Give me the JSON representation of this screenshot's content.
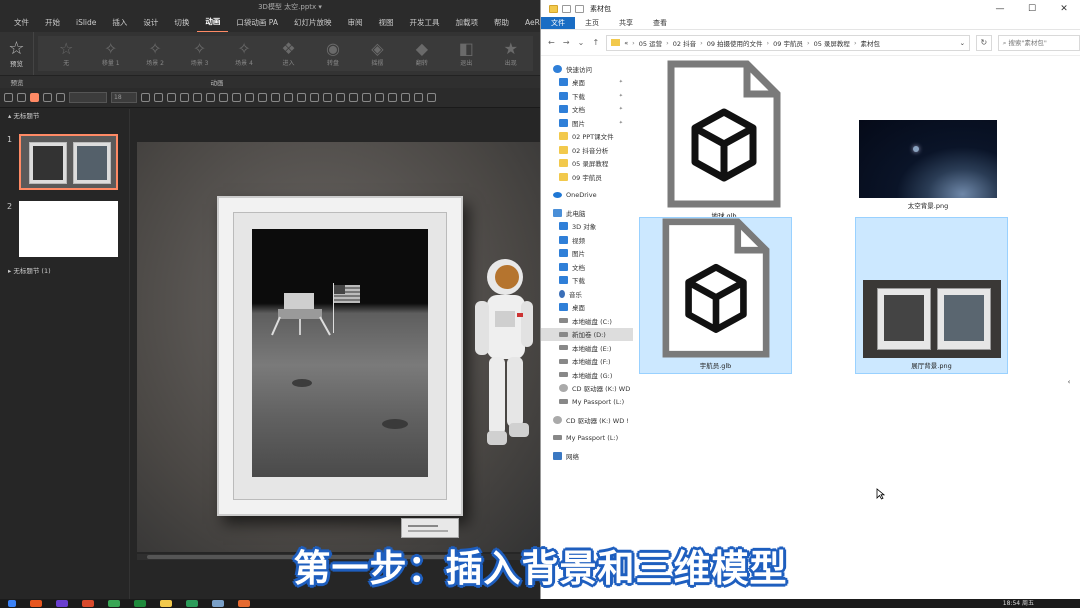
{
  "ppt": {
    "title": "3D模型  太空.pptx  ▾",
    "menu": [
      "文件",
      "开始",
      "iSlide",
      "插入",
      "设计",
      "切换",
      "动画",
      "口袋动画 PA",
      "幻灯片放映",
      "审阅",
      "视图",
      "开发工具",
      "加载项",
      "帮助",
      "AeRender"
    ],
    "active_menu_index": 6,
    "preview_label": "预览",
    "anims": [
      "无",
      "移量 1",
      "场景 2",
      "场景 3",
      "场景 4",
      "进入",
      "转盘",
      "摇摆",
      "翻转",
      "退出",
      "出现"
    ],
    "ribbon_group_left": "预览",
    "ribbon_group_center": "动画",
    "size_field": "18",
    "sections": {
      "first": "无标题节",
      "second": "无标题节 (1)"
    },
    "slides": [
      "1",
      "2"
    ]
  },
  "explorer": {
    "title": "素材包",
    "window_controls": [
      "—",
      "☐",
      "✕"
    ],
    "ribbon_tabs": [
      "文件",
      "主页",
      "共享",
      "查看"
    ],
    "address_crumbs": [
      "«",
      "05 运营",
      "02 抖音",
      "09 拍摄使用的文件",
      "09 宇航员",
      "05 录屏教程",
      "素材包"
    ],
    "search_placeholder": "搜索\"素材包\"",
    "nav_items": [
      {
        "label": "快速访问",
        "icon": "star",
        "indent": 0
      },
      {
        "label": "桌面",
        "icon": "blue",
        "indent": 1,
        "pinned": true
      },
      {
        "label": "下载",
        "icon": "blue",
        "indent": 1,
        "pinned": true
      },
      {
        "label": "文档",
        "icon": "blue",
        "indent": 1,
        "pinned": true
      },
      {
        "label": "图片",
        "icon": "blue",
        "indent": 1,
        "pinned": true
      },
      {
        "label": "02 PPT课文件",
        "icon": "folder",
        "indent": 1
      },
      {
        "label": "02 抖音分析",
        "icon": "folder",
        "indent": 1
      },
      {
        "label": "05 录屏教程",
        "icon": "folder",
        "indent": 1
      },
      {
        "label": "09 宇航员",
        "icon": "folder",
        "indent": 1
      },
      {
        "label": "",
        "icon": "",
        "indent": 0
      },
      {
        "label": "OneDrive",
        "icon": "cloud",
        "indent": 0
      },
      {
        "label": "",
        "icon": "",
        "indent": 0
      },
      {
        "label": "此电脑",
        "icon": "pc",
        "indent": 0
      },
      {
        "label": "3D 对象",
        "icon": "blue",
        "indent": 1
      },
      {
        "label": "视频",
        "icon": "blue",
        "indent": 1
      },
      {
        "label": "图片",
        "icon": "blue",
        "indent": 1
      },
      {
        "label": "文档",
        "icon": "blue",
        "indent": 1
      },
      {
        "label": "下载",
        "icon": "blue",
        "indent": 1
      },
      {
        "label": "音乐",
        "icon": "music",
        "indent": 1
      },
      {
        "label": "桌面",
        "icon": "blue",
        "indent": 1
      },
      {
        "label": "本地磁盘 (C:)",
        "icon": "drive",
        "indent": 1
      },
      {
        "label": "新加卷 (D:)",
        "icon": "drive",
        "indent": 1,
        "selected": true
      },
      {
        "label": "本地磁盘 (E:)",
        "icon": "drive",
        "indent": 1
      },
      {
        "label": "本地磁盘 (F:)",
        "icon": "drive",
        "indent": 1
      },
      {
        "label": "本地磁盘 (G:)",
        "icon": "drive",
        "indent": 1
      },
      {
        "label": "CD 驱动器 (K:) WD",
        "icon": "cd",
        "indent": 1
      },
      {
        "label": "My Passport (L:)",
        "icon": "drive",
        "indent": 1
      },
      {
        "label": "",
        "icon": "",
        "indent": 0
      },
      {
        "label": "CD 驱动器 (K:) WD !",
        "icon": "cd",
        "indent": 0
      },
      {
        "label": "",
        "icon": "",
        "indent": 0
      },
      {
        "label": "My Passport (L:)",
        "icon": "drive",
        "indent": 0
      },
      {
        "label": "",
        "icon": "",
        "indent": 0
      },
      {
        "label": "网络",
        "icon": "net",
        "indent": 0
      }
    ],
    "files": [
      {
        "name": "地球.glb",
        "kind": "glb",
        "selected": false
      },
      {
        "name": "太空背景.png",
        "kind": "space",
        "selected": false
      },
      {
        "name": "宇航员.glb",
        "kind": "glb",
        "selected": true
      },
      {
        "name": "展厅背景.png",
        "kind": "hall",
        "selected": true
      }
    ]
  },
  "caption": "第一步：插入背景和三维模型",
  "taskbar": {
    "clock": "18:54 周五"
  },
  "colors": {
    "accent": "#ff8a65",
    "explorer_blue": "#1a6dc4",
    "selection": "#cce8ff",
    "caption_outline": "#1f5fbf"
  }
}
